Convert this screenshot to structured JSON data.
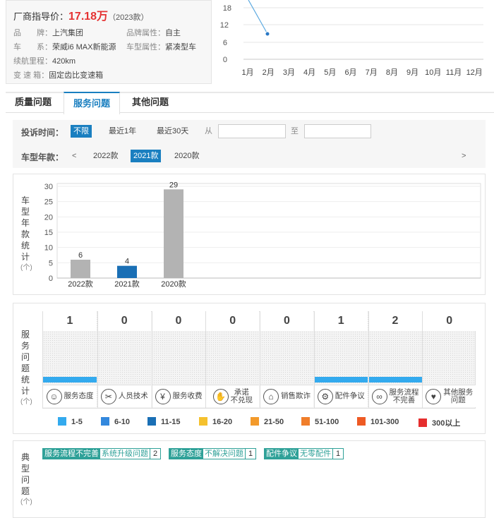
{
  "info": {
    "price_label": "厂商指导价：",
    "price_value": "17.18万",
    "price_year": "（2023款）",
    "rows": [
      {
        "k": "品　　牌：",
        "v": "上汽集团"
      },
      {
        "k": "品牌属性：",
        "v": "自主"
      },
      {
        "k": "车　　系：",
        "v": "荣威i6 MAX新能源"
      },
      {
        "k": "车型属性：",
        "v": "紧凑型车"
      },
      {
        "k": "续航里程：",
        "v": "420km"
      },
      {
        "k": "变 速 箱：",
        "v": "固定齿比变速箱"
      }
    ]
  },
  "trend": {
    "y_ticks": [
      "18",
      "12",
      "6",
      "0"
    ],
    "months": [
      "1月",
      "2月",
      "3月",
      "4月",
      "5月",
      "6月",
      "7月",
      "8月",
      "9月",
      "10月",
      "11月",
      "12月"
    ]
  },
  "tabs": [
    "质量问题",
    "服务问题",
    "其他问题"
  ],
  "active_tab": 1,
  "filter": {
    "time_label": "投诉时间：",
    "time_options": [
      "不限",
      "最近1年",
      "最近30天"
    ],
    "from_label": "从",
    "to_label": "至",
    "from_value": "",
    "to_value": "",
    "year_label": "车型年款：",
    "prev": "<",
    "next": ">",
    "years": [
      "2022款",
      "2021款",
      "2020款"
    ],
    "selected_year": "2021款"
  },
  "year_chart_label": [
    "车",
    "型",
    "年",
    "款",
    "统",
    "计"
  ],
  "service_chart_label": [
    "服",
    "务",
    "问",
    "题",
    "统",
    "计"
  ],
  "typical_label": [
    "典",
    "型",
    "问",
    "题"
  ],
  "unit": "(个)",
  "chart_data": {
    "type": "bar",
    "categories": [
      "2022款",
      "2021款",
      "2020款"
    ],
    "values": [
      6,
      4,
      29
    ],
    "highlight": "2021款",
    "ylim": [
      0,
      30
    ],
    "y_ticks": [
      30,
      25,
      20,
      15,
      10,
      5,
      0
    ],
    "colors": {
      "default": "#b3b3b3",
      "highlight": "#1a6fb5"
    }
  },
  "service": [
    {
      "icon": "smile-icon",
      "glyph": "☺",
      "label": [
        "服务态度"
      ],
      "count": "1",
      "value": 1
    },
    {
      "icon": "tools-icon",
      "glyph": "✂",
      "label": [
        "人员技术"
      ],
      "count": "0",
      "value": 0
    },
    {
      "icon": "money-bag-icon",
      "glyph": "¥",
      "label": [
        "服务收费"
      ],
      "count": "0",
      "value": 0
    },
    {
      "icon": "handshake-icon",
      "glyph": "✋",
      "label": [
        "承诺",
        "不兑现"
      ],
      "count": "0",
      "value": 0
    },
    {
      "icon": "house-icon",
      "glyph": "⌂",
      "label": [
        "销售欺诈"
      ],
      "count": "0",
      "value": 0
    },
    {
      "icon": "gear-icon",
      "glyph": "⚙",
      "label": [
        "配件争议"
      ],
      "count": "1",
      "value": 1
    },
    {
      "icon": "link-icon",
      "glyph": "∞",
      "label": [
        "服务流程",
        "不完善"
      ],
      "count": "2",
      "value": 2
    },
    {
      "icon": "heart-icon",
      "glyph": "♥",
      "label": [
        "其他服务",
        "问题"
      ],
      "count": "0",
      "value": 0
    }
  ],
  "legend": [
    {
      "label": "1-5",
      "color": "#33aaee"
    },
    {
      "label": "6-10",
      "color": "#3388dd"
    },
    {
      "label": "11-15",
      "color": "#1a6fb5"
    },
    {
      "label": "16-20",
      "color": "#f5c12e"
    },
    {
      "label": "21-50",
      "color": "#f39a2b"
    },
    {
      "label": "51-100",
      "color": "#f07e2a"
    },
    {
      "label": "101-300",
      "color": "#ee5a24"
    },
    {
      "label": "300以上",
      "color": "#e52e2e"
    }
  ],
  "typical": [
    {
      "cat": "服务流程不完善",
      "sub": "系统升级问题",
      "count": "2"
    },
    {
      "cat": "服务态度",
      "sub": "不解决问题",
      "count": "1"
    },
    {
      "cat": "配件争议",
      "sub": "无零配件",
      "count": "1"
    }
  ]
}
